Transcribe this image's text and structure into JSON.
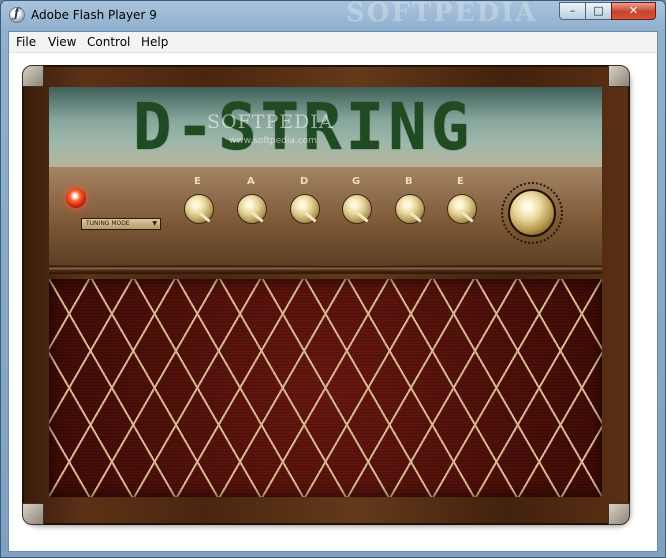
{
  "window": {
    "title": "Adobe Flash Player 9",
    "watermark": "SOFTPEDIA",
    "controls": {
      "minimize": "–",
      "maximize": "□",
      "close": "✕"
    }
  },
  "menu": {
    "items": [
      "File",
      "View",
      "Control",
      "Help"
    ]
  },
  "amp": {
    "display": "D-STRING",
    "watermark": "SOFTPEDIA",
    "watermark_url": "www.softpedia.com",
    "mode_button": {
      "label": "TUNING MODE",
      "arrow": "▼"
    },
    "strings": [
      "E",
      "A",
      "D",
      "G",
      "B",
      "E"
    ],
    "colors": {
      "display_text": "#1f4a22",
      "led": "#d12710",
      "grille": "#4a0f0a",
      "piping": "#e3c79e"
    }
  }
}
